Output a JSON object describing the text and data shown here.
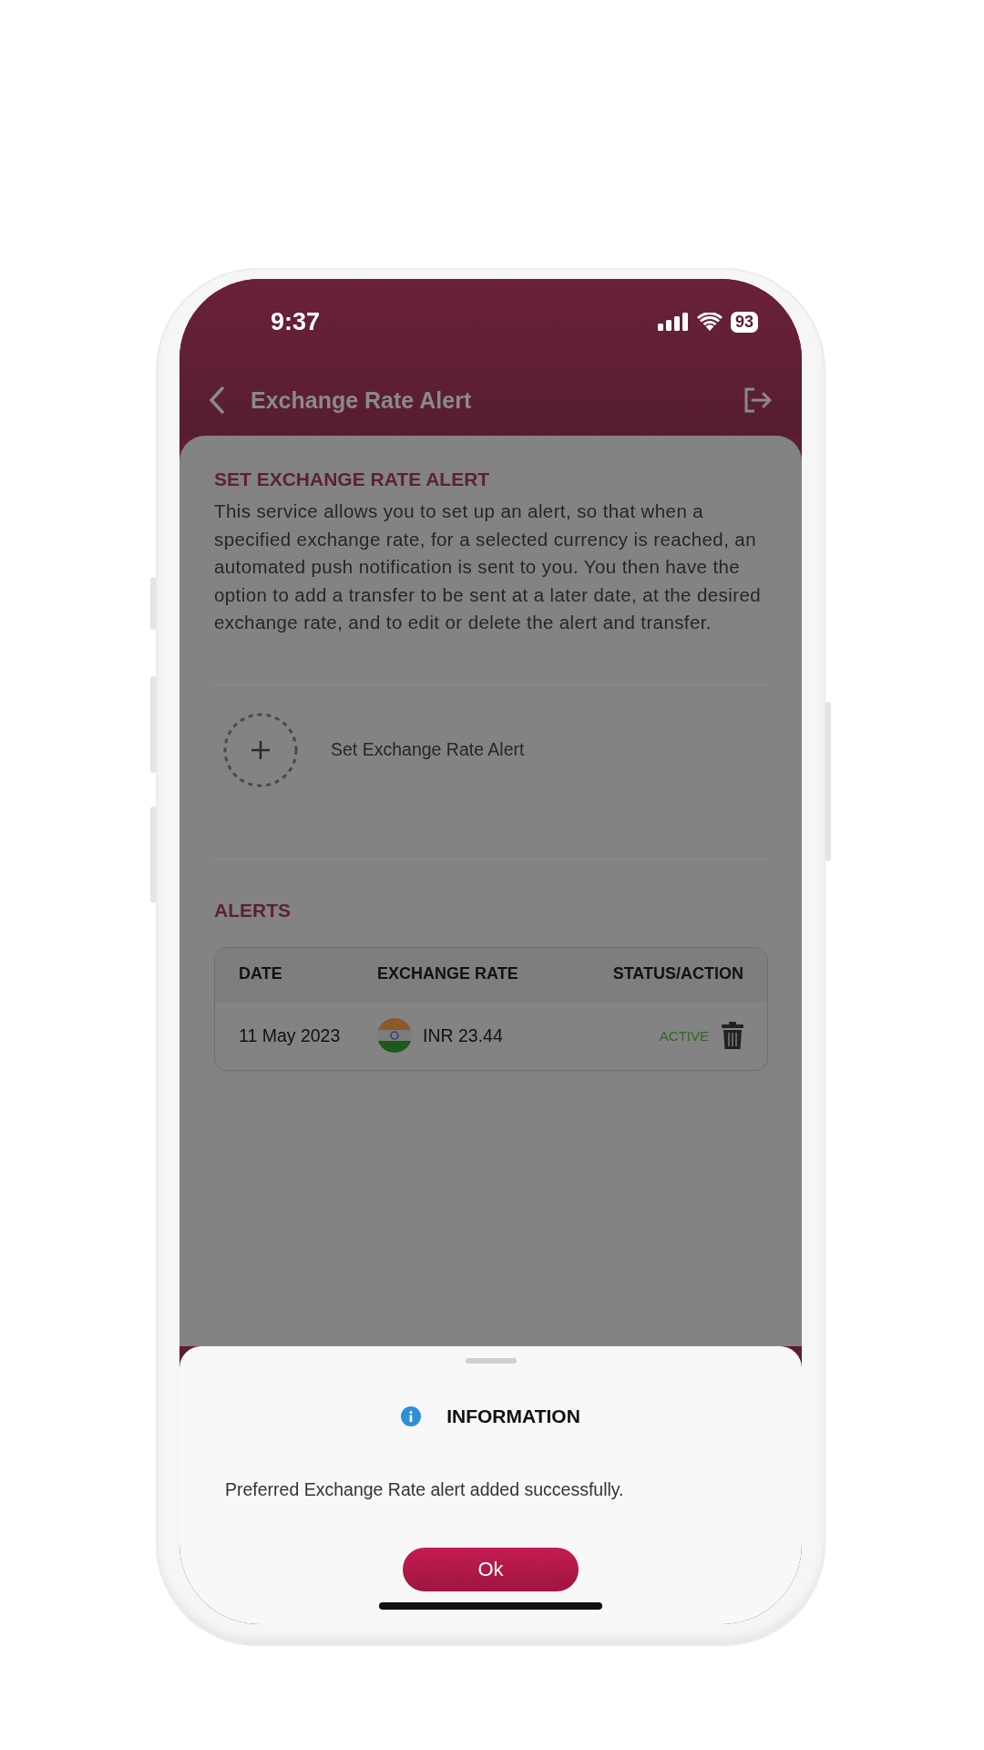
{
  "status_bar": {
    "time": "9:37",
    "battery": "93"
  },
  "header": {
    "title": "Exchange Rate Alert"
  },
  "intro": {
    "heading": "SET EXCHANGE RATE ALERT",
    "text": "This service allows you to set up an alert, so that when a specified exchange rate, for a selected currency is reached, an automated push notification is sent to you. You then have the option to add a transfer to be sent at a later date, at the desired exchange rate, and to edit or delete the alert and transfer."
  },
  "add_action": {
    "label": "Set Exchange Rate Alert"
  },
  "alerts": {
    "heading": "ALERTS",
    "columns": [
      "DATE",
      "EXCHANGE RATE",
      "STATUS/ACTION"
    ],
    "rows": [
      {
        "date": "11 May 2023",
        "rate": "INR 23.44",
        "status": "ACTIVE"
      }
    ]
  },
  "dialog": {
    "title": "INFORMATION",
    "message": "Preferred Exchange Rate alert added successfully.",
    "button": "Ok"
  }
}
